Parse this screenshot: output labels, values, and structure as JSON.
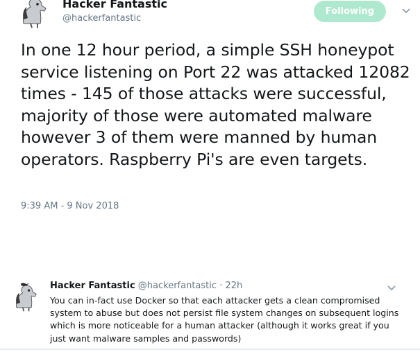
{
  "main_tweet": {
    "display_name": "Hacker Fantastic",
    "handle": "@hackerfantastic",
    "follow_button_label": "Following",
    "text": "In one 12 hour period, a simple SSH honeypot service listening on Port 22 was attacked 12082 times - 145 of those attacks were successful, majority of those were automated malware however 3 of them were manned by human operators. Raspberry Pi's are even targets.",
    "timestamp": "9:39 AM - 9 Nov 2018",
    "avatar_icon": "avatar-pony-icon",
    "menu_icon": "chevron-down-icon"
  },
  "reply_tweet": {
    "display_name": "Hacker Fantastic",
    "handle": "@hackerfantastic",
    "separator": "·",
    "age": "22h",
    "text": "You can in-fact use Docker so that each attacker gets a clean compromised system to abuse but does not persist file system changes on subsequent logins which is more noticeable for a human attacker (although it works great if you just want malware samples and passwords)",
    "avatar_icon": "avatar-pony-icon",
    "menu_icon": "chevron-down-icon"
  },
  "colors": {
    "follow_button": "#aee8cf",
    "primary_text": "#14171a",
    "secondary_text": "#657786"
  }
}
